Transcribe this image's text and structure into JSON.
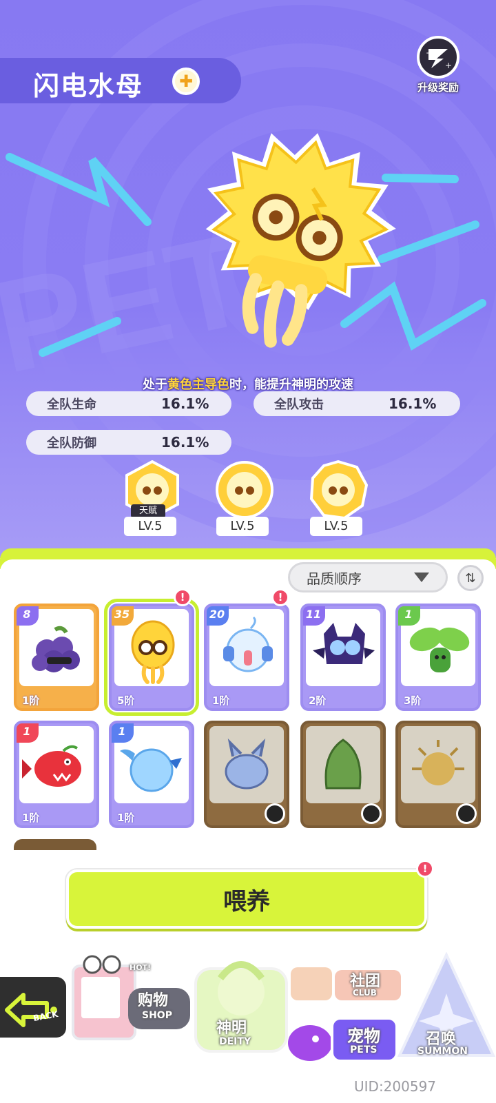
{
  "pet": {
    "name": "闪电水母",
    "element_icon": "lightning-element-icon"
  },
  "header": {
    "upgrade_reward_label": "升级奖励"
  },
  "skill": {
    "prefix": "处于",
    "highlight": "黄色主导色",
    "suffix": "时，能提升神明的攻速"
  },
  "stats": [
    {
      "name": "全队生命",
      "value": "16.1%"
    },
    {
      "name": "全队攻击",
      "value": "16.1%"
    },
    {
      "name": "全队防御",
      "value": "16.1%"
    }
  ],
  "talents": [
    {
      "tag": "天赋",
      "level": "LV.5"
    },
    {
      "level": "LV.5"
    },
    {
      "level": "LV.5"
    }
  ],
  "sort": {
    "selected": "品质顺序"
  },
  "pets": [
    {
      "level": "8",
      "stage": "1阶",
      "color": "#f3a43b",
      "icon": "grape-pet",
      "notice": false,
      "locked": false,
      "selected": false
    },
    {
      "level": "35",
      "stage": "5阶",
      "color": "#9d8df0",
      "icon": "lightning-jellyfish-pet",
      "notice": true,
      "locked": false,
      "selected": true
    },
    {
      "level": "20",
      "stage": "1阶",
      "color": "#9d8df0",
      "icon": "water-spirit-pet",
      "notice": true,
      "locked": false,
      "selected": false
    },
    {
      "level": "11",
      "stage": "2阶",
      "color": "#9d8df0",
      "icon": "shadow-bat-pet",
      "notice": false,
      "locked": false,
      "selected": false
    },
    {
      "level": "1",
      "stage": "3阶",
      "color": "#9d8df0",
      "icon": "sprout-pet",
      "notice": false,
      "locked": false,
      "selected": false
    },
    {
      "level": "1",
      "stage": "1阶",
      "color": "#9d8df0",
      "icon": "red-piranha-pet",
      "notice": false,
      "locked": false,
      "selected": false
    },
    {
      "level": "1",
      "stage": "1阶",
      "color": "#9d8df0",
      "icon": "bubble-bird-pet",
      "notice": false,
      "locked": false,
      "selected": false
    },
    {
      "icon": "blue-axolotl-pet",
      "locked": true
    },
    {
      "icon": "green-leaf-pet",
      "locked": true
    },
    {
      "icon": "puffer-pet",
      "locked": true
    }
  ],
  "feed_button": "喂养",
  "nav": {
    "back": "BACK",
    "shop_zh": "购物",
    "shop_en": "SHOP",
    "shop_hot": "HOT!",
    "deity_zh": "神明",
    "deity_en": "DEITY",
    "club_zh": "社团",
    "club_en": "CLUB",
    "pets_zh": "宠物",
    "pets_en": "PETS",
    "summon_zh": "召唤",
    "summon_en": "SUMMON"
  },
  "uid": "UID:200597",
  "colors": {
    "bg_purple": "#8779f2",
    "accent_lime": "#d8f43a",
    "notice_red": "#f04a68",
    "highlight_yellow": "#ffd43a"
  }
}
